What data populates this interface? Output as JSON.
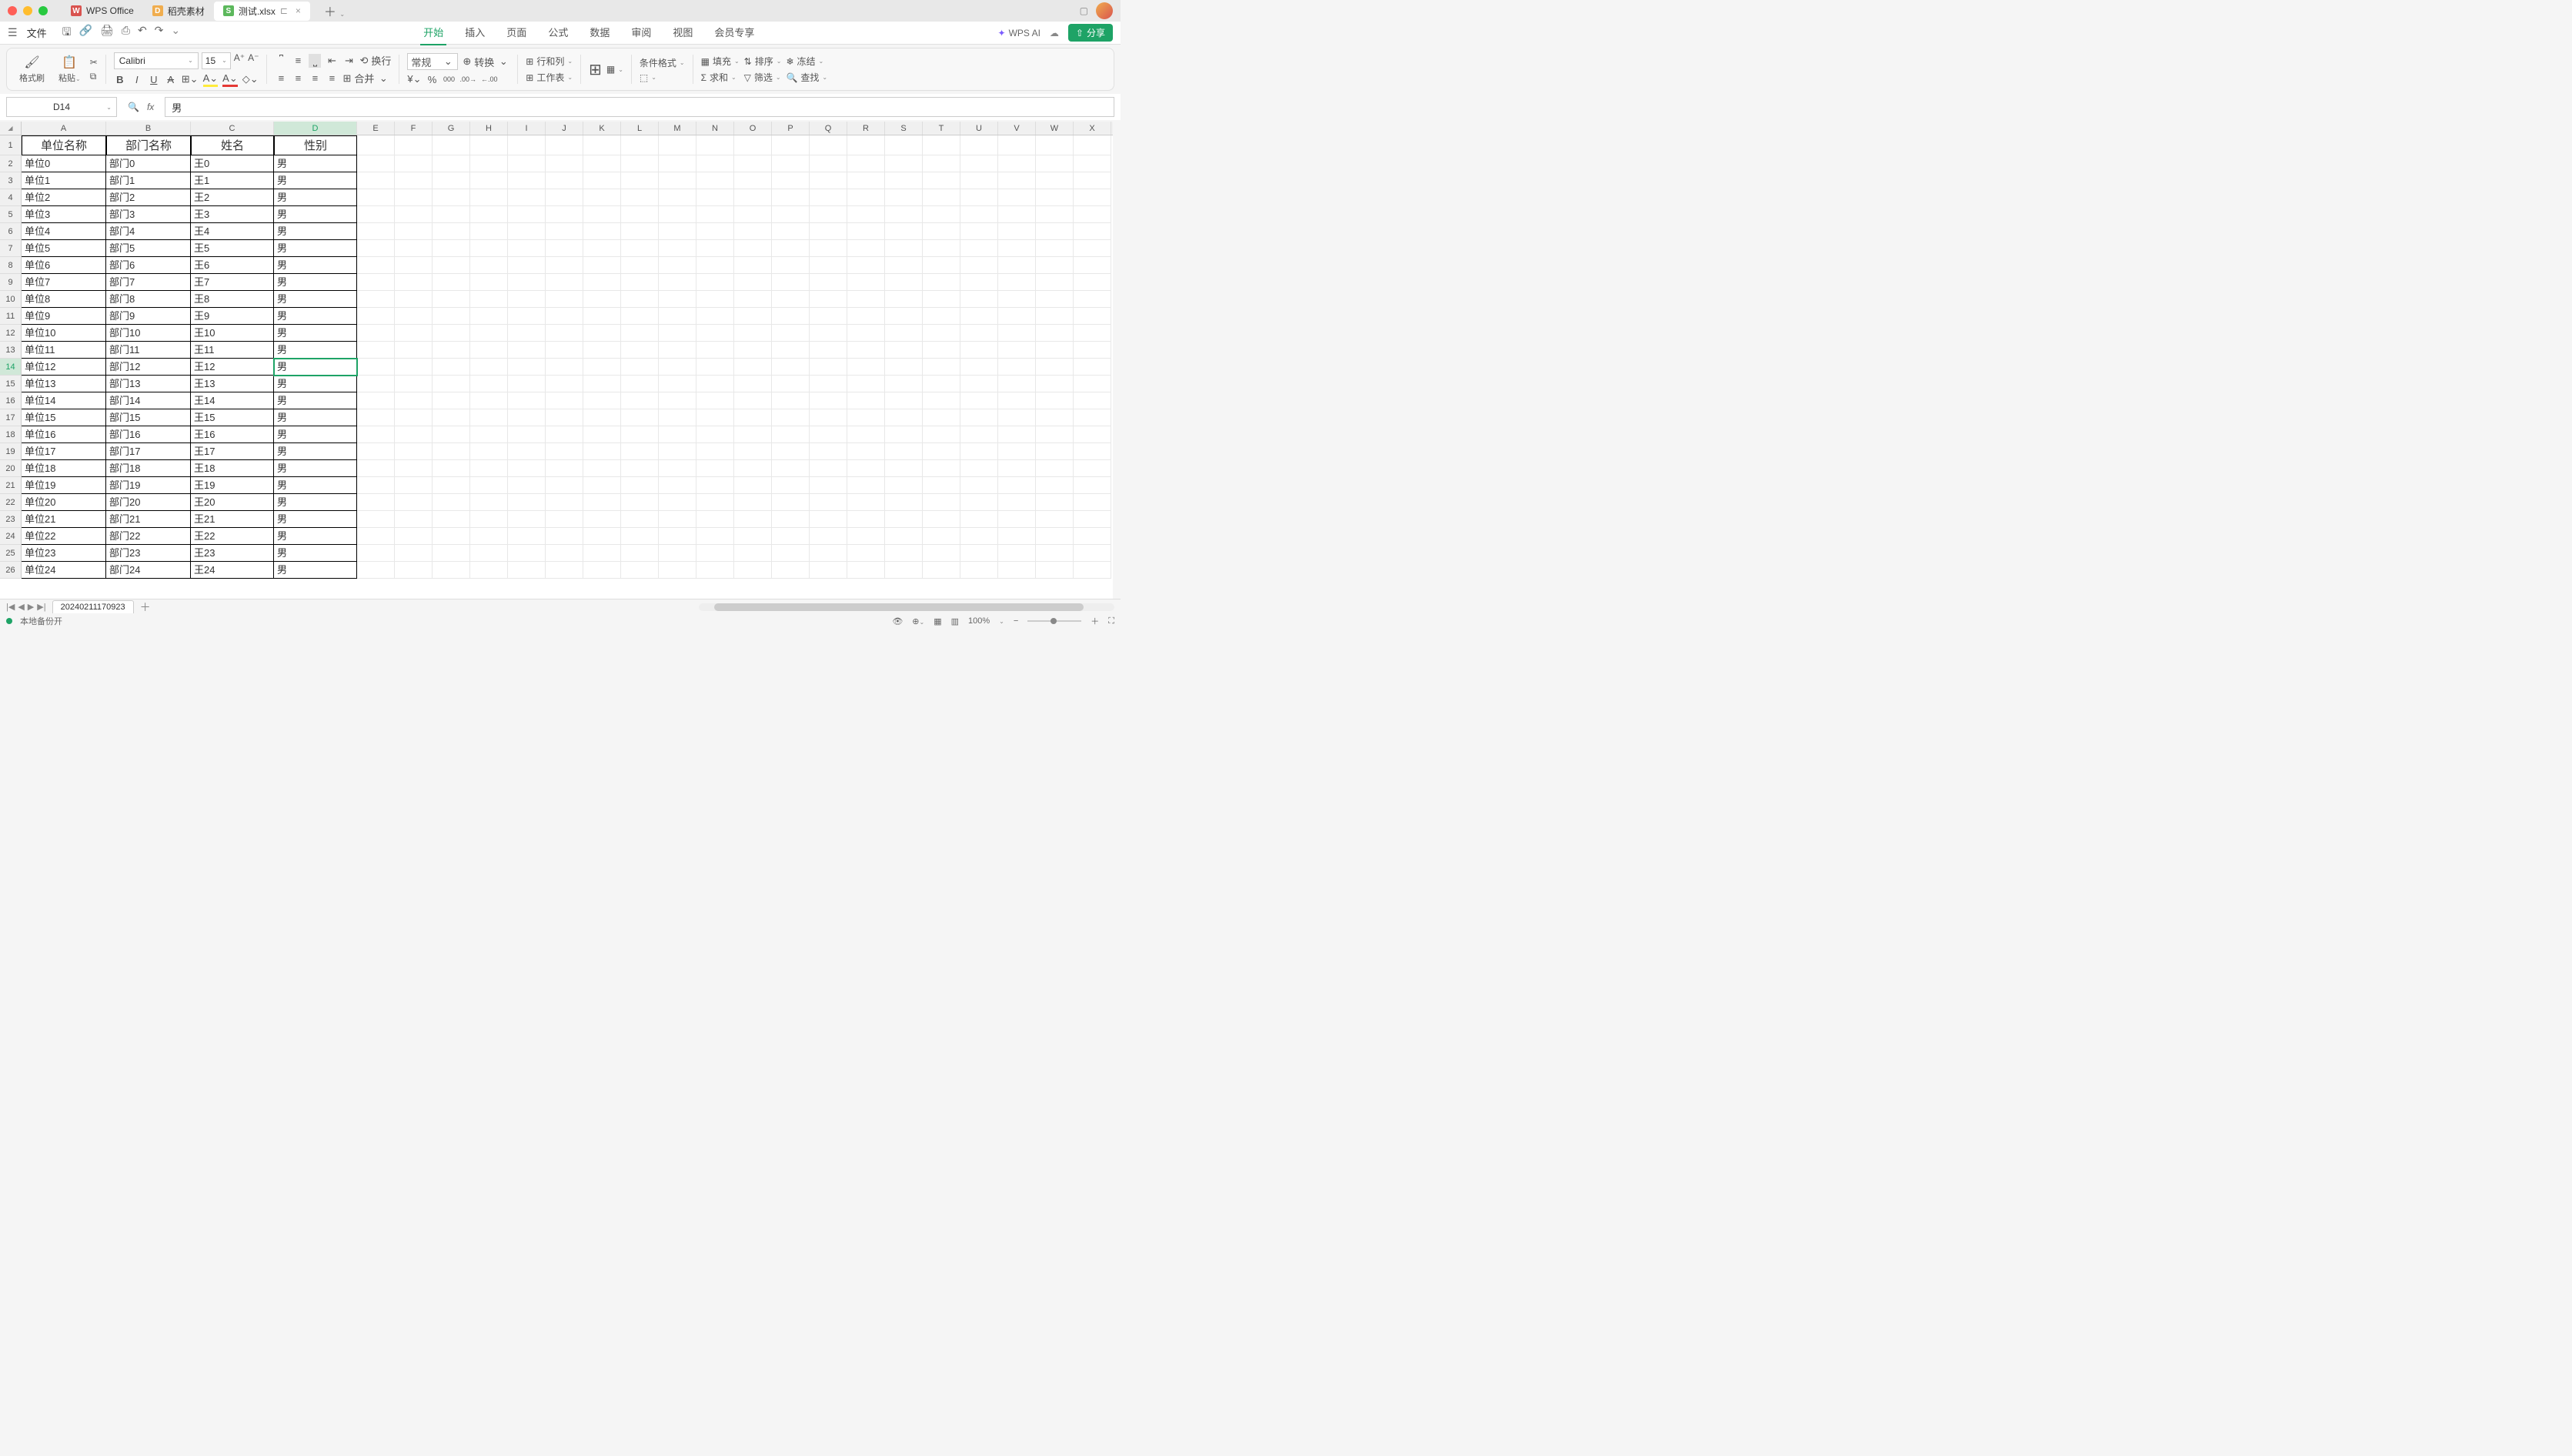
{
  "titlebar": {
    "tabs": [
      {
        "icon": "W",
        "label": "WPS Office",
        "iconClass": "icon-wps"
      },
      {
        "icon": "D",
        "label": "稻壳素材",
        "iconClass": "icon-dk"
      },
      {
        "icon": "S",
        "label": "测试.xlsx",
        "iconClass": "icon-s",
        "active": true,
        "closable": true
      }
    ]
  },
  "menu": {
    "file": "文件",
    "tabs": [
      "开始",
      "插入",
      "页面",
      "公式",
      "数据",
      "审阅",
      "视图",
      "会员专享"
    ],
    "active_tab": "开始",
    "wps_ai": "WPS AI",
    "share": "分享"
  },
  "ribbon": {
    "format_painter": "格式刷",
    "paste": "粘贴",
    "font_name": "Calibri",
    "font_size": "15",
    "wrap": "换行",
    "merge": "合并",
    "number_format": "常规",
    "convert": "转换",
    "rowcol": "行和列",
    "worksheet": "工作表",
    "cond_fmt": "条件格式",
    "fill": "填充",
    "sort": "排序",
    "sum": "求和",
    "filter": "筛选",
    "freeze": "冻结",
    "find": "查找"
  },
  "formula_bar": {
    "name_box": "D14",
    "formula": "男"
  },
  "grid": {
    "columns": [
      "A",
      "B",
      "C",
      "D",
      "E",
      "F",
      "G",
      "H",
      "I",
      "J",
      "K",
      "L",
      "M",
      "N",
      "O",
      "P",
      "Q",
      "R",
      "S",
      "T",
      "U",
      "V",
      "W",
      "X"
    ],
    "selected_col": "D",
    "selected_row": 14,
    "headers": [
      "单位名称",
      "部门名称",
      "姓名",
      "性别"
    ],
    "rows": [
      [
        "单位0",
        "部门0",
        "王0",
        "男"
      ],
      [
        "单位1",
        "部门1",
        "王1",
        "男"
      ],
      [
        "单位2",
        "部门2",
        "王2",
        "男"
      ],
      [
        "单位3",
        "部门3",
        "王3",
        "男"
      ],
      [
        "单位4",
        "部门4",
        "王4",
        "男"
      ],
      [
        "单位5",
        "部门5",
        "王5",
        "男"
      ],
      [
        "单位6",
        "部门6",
        "王6",
        "男"
      ],
      [
        "单位7",
        "部门7",
        "王7",
        "男"
      ],
      [
        "单位8",
        "部门8",
        "王8",
        "男"
      ],
      [
        "单位9",
        "部门9",
        "王9",
        "男"
      ],
      [
        "单位10",
        "部门10",
        "王10",
        "男"
      ],
      [
        "单位11",
        "部门11",
        "王11",
        "男"
      ],
      [
        "单位12",
        "部门12",
        "王12",
        "男"
      ],
      [
        "单位13",
        "部门13",
        "王13",
        "男"
      ],
      [
        "单位14",
        "部门14",
        "王14",
        "男"
      ],
      [
        "单位15",
        "部门15",
        "王15",
        "男"
      ],
      [
        "单位16",
        "部门16",
        "王16",
        "男"
      ],
      [
        "单位17",
        "部门17",
        "王17",
        "男"
      ],
      [
        "单位18",
        "部门18",
        "王18",
        "男"
      ],
      [
        "单位19",
        "部门19",
        "王19",
        "男"
      ],
      [
        "单位20",
        "部门20",
        "王20",
        "男"
      ],
      [
        "单位21",
        "部门21",
        "王21",
        "男"
      ],
      [
        "单位22",
        "部门22",
        "王22",
        "男"
      ],
      [
        "单位23",
        "部门23",
        "王23",
        "男"
      ],
      [
        "单位24",
        "部门24",
        "王24",
        "男"
      ]
    ]
  },
  "sheet": {
    "name": "20240211170923"
  },
  "status": {
    "text": "本地备份开",
    "zoom": "100%"
  }
}
